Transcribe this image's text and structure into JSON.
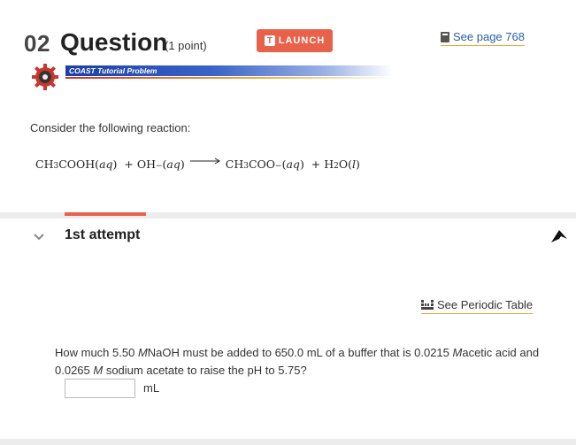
{
  "header": {
    "question_number": "02",
    "question_word": "Question",
    "points": "(1 point)",
    "launch_label": "LAUNCH",
    "launch_icon_letter": "T",
    "see_page_label": "See page 768"
  },
  "coast": {
    "label": "COAST Tutorial Problem"
  },
  "problem": {
    "intro": "Consider the following reaction:",
    "reaction": {
      "reactant1_a": "CH",
      "reactant1_sub": "3",
      "reactant1_b": "COOH",
      "reactant1_state": "aq",
      "plus1": "+",
      "reactant2": "OH",
      "reactant2_charge": "−",
      "reactant2_state": "aq",
      "product1_a": "CH",
      "product1_sub": "3",
      "product1_b": "COO",
      "product1_charge": "−",
      "product1_state": "aq",
      "plus2": "+",
      "product2_a": "H",
      "product2_sub": "2",
      "product2_b": "O",
      "product2_state": "l"
    }
  },
  "attempt": {
    "title": "1st attempt",
    "periodic_table_label": "See Periodic Table",
    "question_parts": {
      "p1": "How much 5.50 ",
      "m1": "M",
      "p2": "NaOH must be added to 650.0 mL of a buffer that is 0.0215 ",
      "m2": "M",
      "p3": "acetic acid and 0.0265 ",
      "m3": "M",
      "p4": " sodium acetate to raise the pH to 5.75?"
    },
    "answer_value": "",
    "unit": "mL"
  },
  "colors": {
    "accent": "#e8614a",
    "link": "#2a5fa8",
    "underline": "#f0a030"
  },
  "icons": {
    "launch": "t-icon",
    "see_page": "book-icon",
    "coast": "gear-icon",
    "chevron": "chevron-down-icon",
    "flag": "flag-icon",
    "periodic": "periodic-table-icon"
  }
}
